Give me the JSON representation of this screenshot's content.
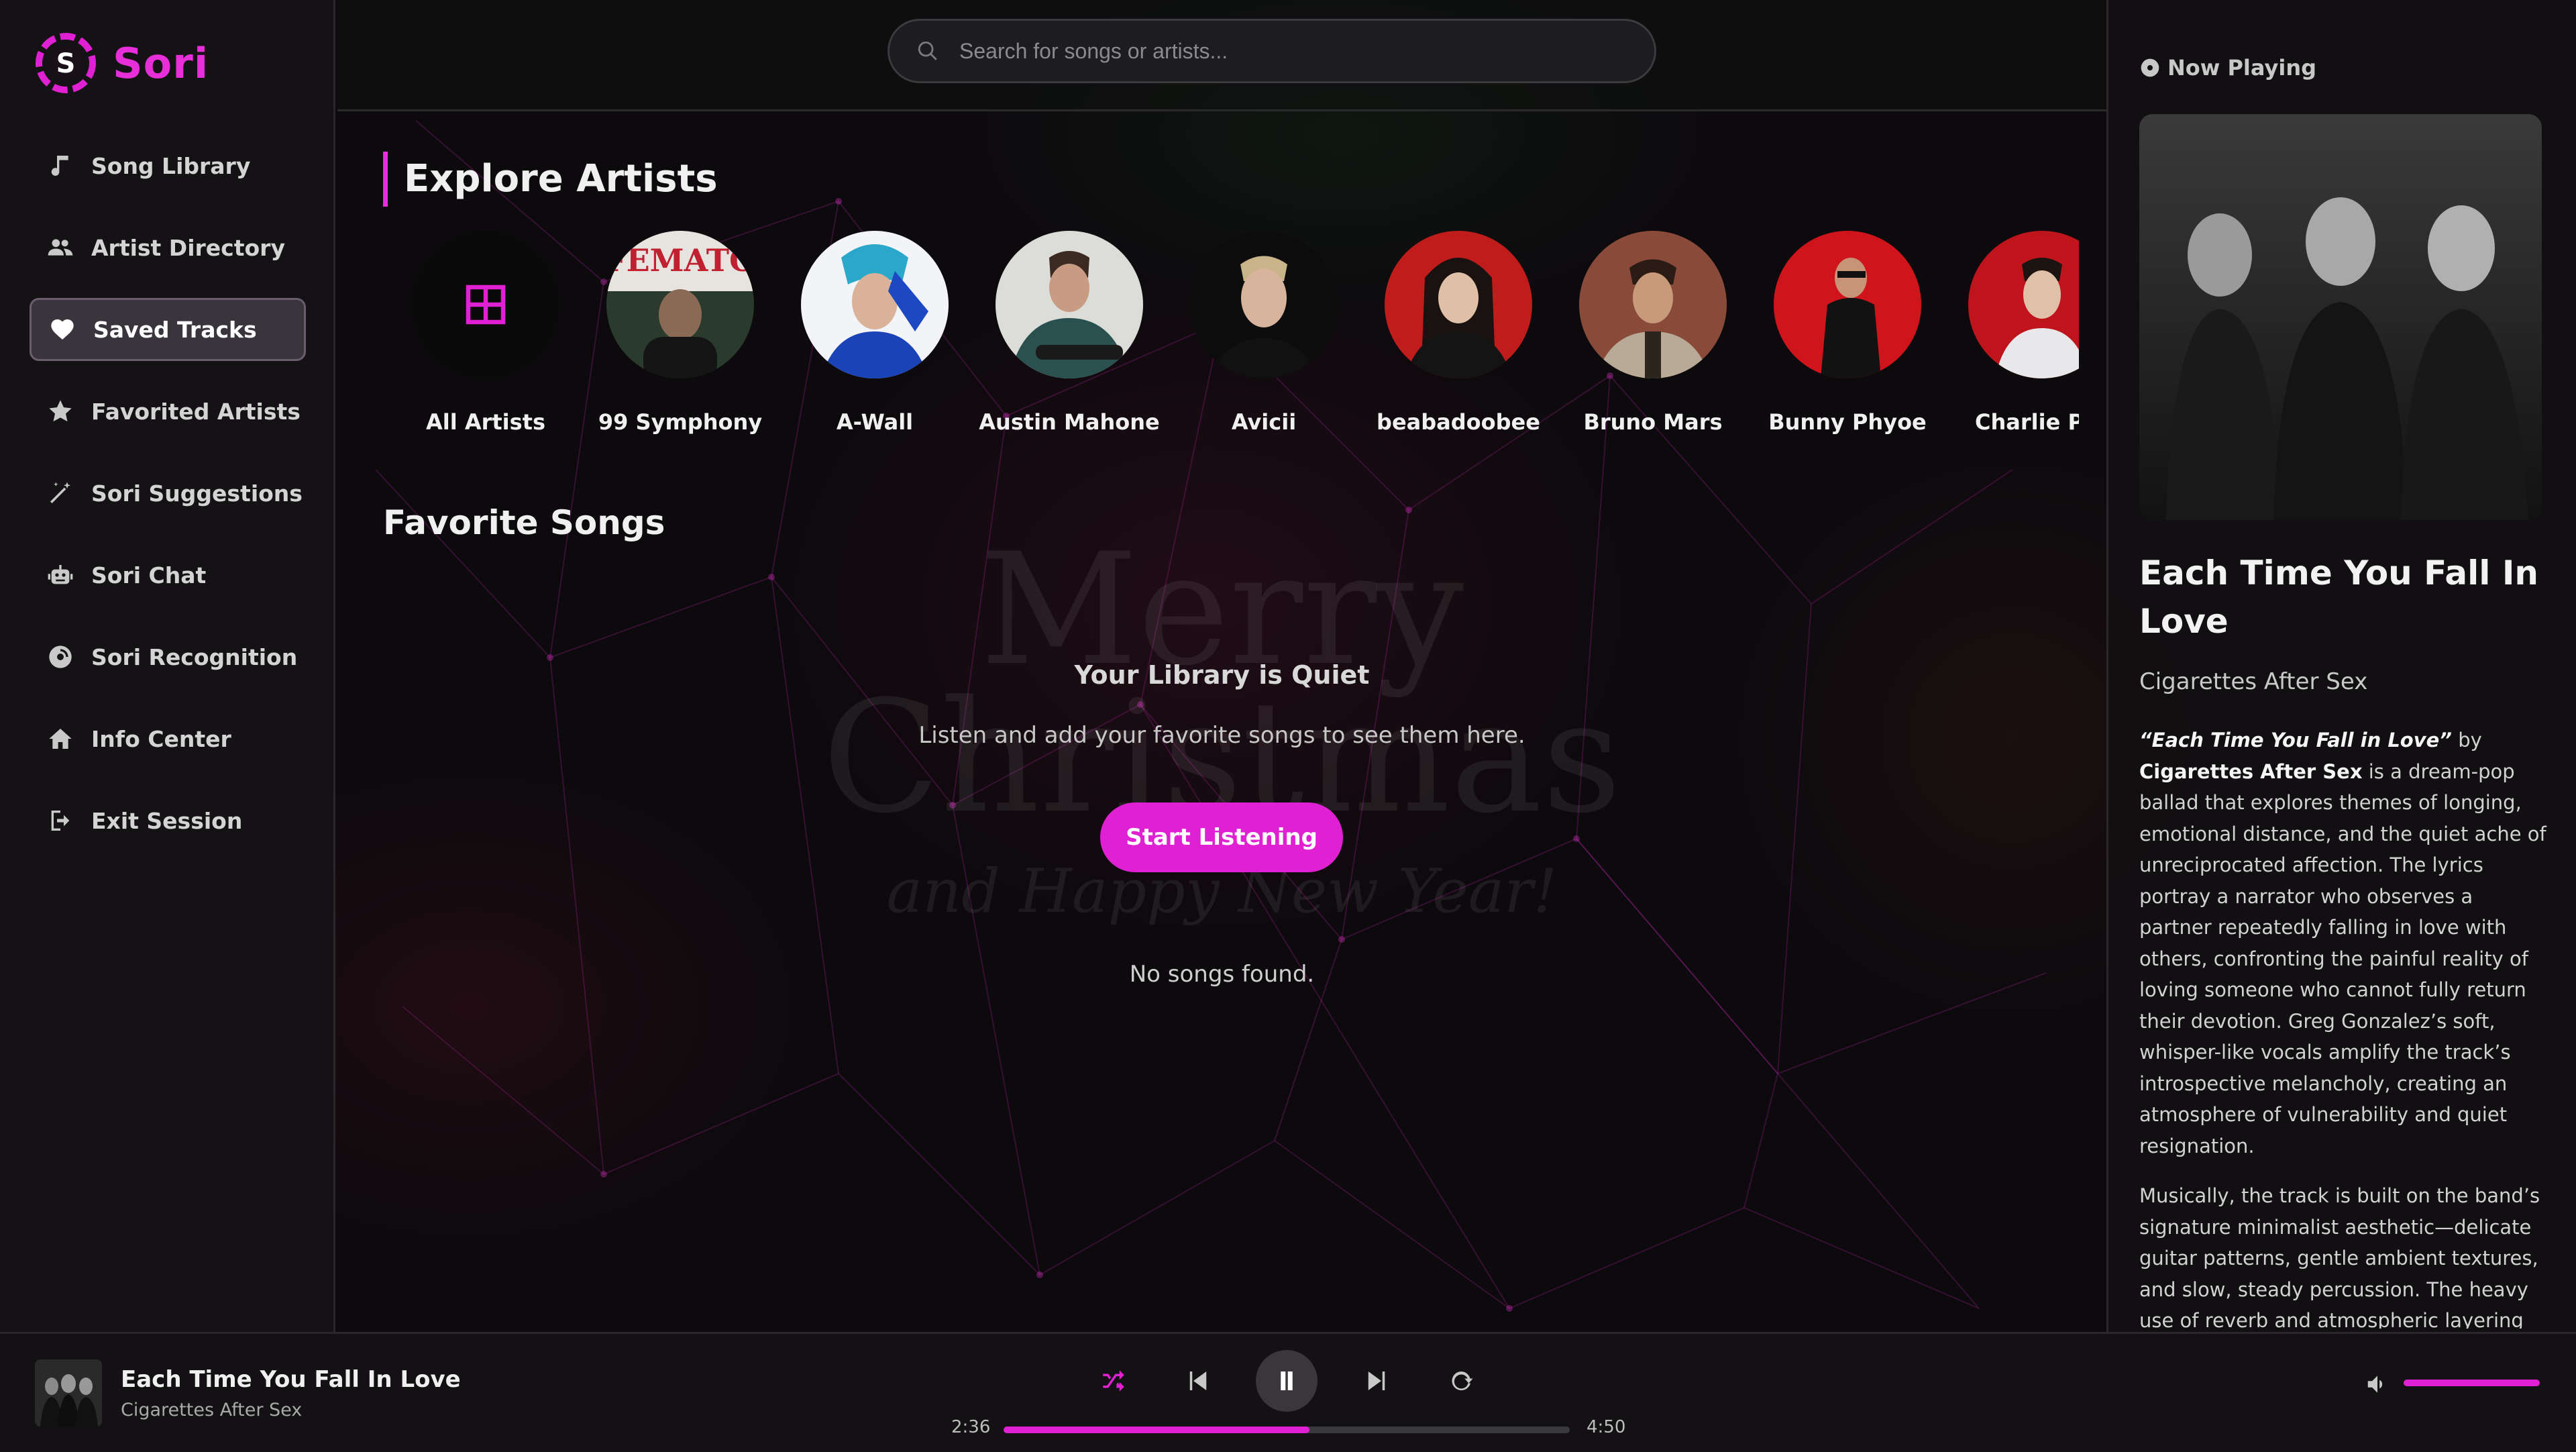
{
  "app": {
    "name": "Sori",
    "accent": "#e020d3"
  },
  "sidebar": {
    "items": [
      {
        "label": "Song Library",
        "icon": "music-note-icon",
        "active": false
      },
      {
        "label": "Artist Directory",
        "icon": "users-icon",
        "active": false
      },
      {
        "label": "Saved Tracks",
        "icon": "heart-icon",
        "active": true
      },
      {
        "label": "Favorited Artists",
        "icon": "star-icon",
        "active": false
      },
      {
        "label": "Sori Suggestions",
        "icon": "magic-wand-icon",
        "active": false
      },
      {
        "label": "Sori Chat",
        "icon": "robot-icon",
        "active": false
      },
      {
        "label": "Sori Recognition",
        "icon": "record-icon",
        "active": false
      },
      {
        "label": "Info Center",
        "icon": "home-icon",
        "active": false
      },
      {
        "label": "Exit Session",
        "icon": "logout-icon",
        "active": false
      }
    ]
  },
  "search": {
    "placeholder": "Search for songs or artists..."
  },
  "main": {
    "explore_title": "Explore Artists",
    "artists": [
      {
        "name": "All Artists"
      },
      {
        "name": "99 Symphony"
      },
      {
        "name": "A-Wall"
      },
      {
        "name": "Austin Mahone"
      },
      {
        "name": "Avicii"
      },
      {
        "name": "beabadoobee"
      },
      {
        "name": "Bruno Mars"
      },
      {
        "name": "Bunny Phyoe"
      },
      {
        "name": "Charlie Put"
      }
    ],
    "favorite_title": "Favorite Songs",
    "empty_title": "Your Library is Quiet",
    "empty_subtitle": "Listen and add your favorite songs to see them here.",
    "start_button": "Start Listening",
    "no_songs": "No songs found.",
    "background_text": {
      "line1": "Merry",
      "line2": "Christmas",
      "line3": "and Happy New Year!"
    }
  },
  "now_playing": {
    "label": "Now Playing",
    "title": "Each Time You Fall In Love",
    "artist": "Cigarettes After Sex",
    "desc1_title": "“Each Time You Fall in Love”",
    "desc1_by": " by ",
    "desc1_artist": "Cigarettes After Sex",
    "desc1_rest": " is a dream-pop ballad that explores themes of longing, emotional distance, and the quiet ache of unreciprocated affection. The lyrics portray a narrator who observes a partner repeatedly falling in love with others, confronting the painful reality of loving someone who cannot fully return their devotion. Greg Gonzalez’s soft, whisper-like vocals amplify the track’s introspective melancholy, creating an atmosphere of vulnerability and quiet resignation.",
    "desc2": "Musically, the track is built on the band’s signature minimalist aesthetic—delicate guitar patterns, gentle ambient textures, and slow, steady percussion. The heavy use of reverb and atmospheric layering"
  },
  "player": {
    "title": "Each Time You Fall In Love",
    "artist": "Cigarettes After Sex",
    "elapsed": "2:36",
    "duration": "4:50",
    "progress": 0.54,
    "volume": 1.0
  }
}
